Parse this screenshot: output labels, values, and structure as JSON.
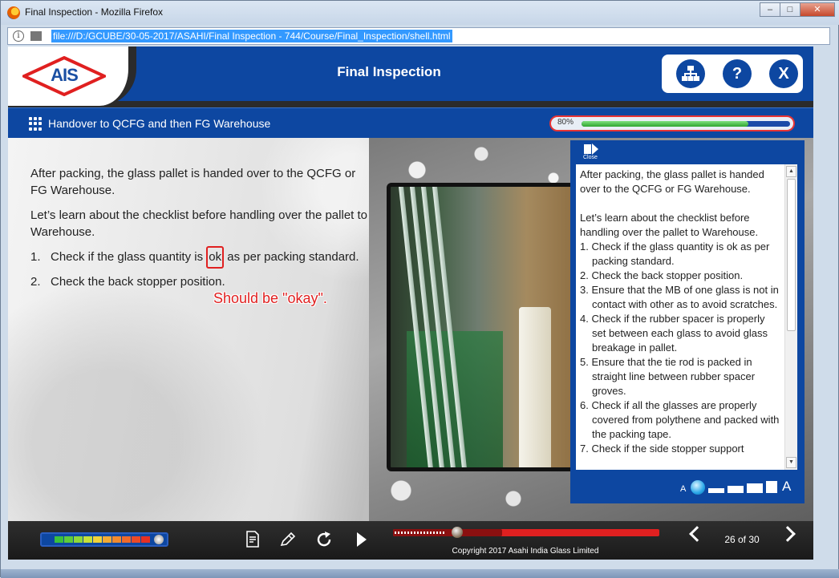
{
  "browser": {
    "window_title": "Final Inspection - Mozilla Firefox",
    "url": "file:///D:/GCUBE/30-05-2017/ASAHI/Final Inspection - 744/Course/Final_Inspection/shell.html",
    "controls": {
      "minimize": "–",
      "maximize": "□",
      "close": "✕"
    }
  },
  "header": {
    "logo_text": "AIS",
    "title": "Final Inspection",
    "buttons": {
      "menu_icon": "sitemap-icon",
      "help": "?",
      "exit": "X"
    }
  },
  "subheader": {
    "topic": "Handover to QCFG and then FG Warehouse",
    "progress_label": "80%",
    "progress_value": 0.8
  },
  "content": {
    "intro": "After packing, the glass pallet is handed over to the QCFG or FG Warehouse.",
    "lead": "Let’s learn about the checklist before handling over the pallet to Warehouse.",
    "list": [
      {
        "num": "1.",
        "before": "Check if the glass quantity is ",
        "highlight": "ok",
        "after": " as per packing standard."
      },
      {
        "num": "2.",
        "text": "Check the back stopper position."
      }
    ],
    "annotation": "Should be \"okay\"."
  },
  "transcript": {
    "close_label": "Close",
    "intro": "After packing, the glass pallet is handed over to the QCFG or FG Warehouse.",
    "lead": "Let’s learn about the checklist before handling over the pallet to Warehouse.",
    "items": [
      "1. Check if the glass quantity is ok as per packing standard.",
      "2. Check the back stopper position.",
      "3. Ensure that the MB of one glass is not in contact with other as to avoid scratches.",
      "4. Check if the rubber spacer is properly set between each glass to avoid glass breakage in pallet.",
      "5. Ensure that the tie rod is packed in straight line between rubber spacer groves.",
      "6. Check if all the glasses are properly covered from polythene and packed with the packing tape.",
      "7. Check if the side stopper support"
    ],
    "font_small": "A",
    "font_large": "A"
  },
  "footer": {
    "copyright": "Copyright 2017 Asahi India Glass Limited",
    "page_indicator": "26 of 30",
    "seek_played": 0.24,
    "seek_buffered": 0.41,
    "icons": [
      "notes-icon",
      "pencil-icon",
      "replay-icon",
      "play-icon",
      "prev-icon",
      "next-icon"
    ]
  },
  "colors": {
    "brand_blue": "#0d47a1",
    "accent_red": "#e02020",
    "progress_green": "#2fa52f"
  }
}
